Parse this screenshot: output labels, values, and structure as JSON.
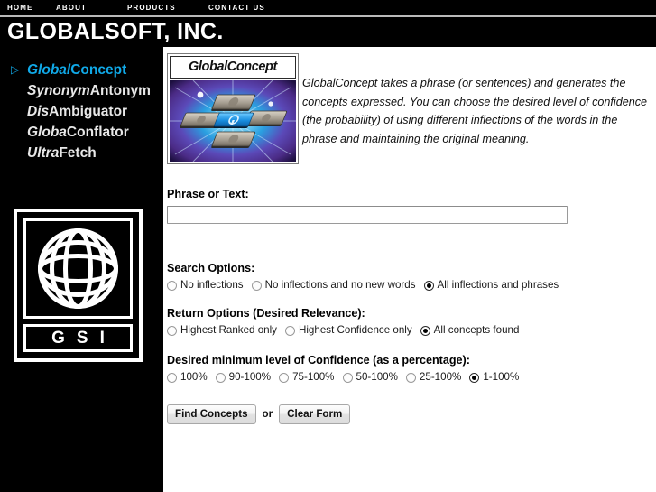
{
  "topnav": {
    "items": [
      {
        "label": "HOME"
      },
      {
        "label": "ABOUT"
      },
      {
        "label": "PRODUCTS"
      },
      {
        "label": "CONTACT US"
      }
    ]
  },
  "masthead": {
    "company": "GLOBALSOFT, INC."
  },
  "sidebar": {
    "items": [
      {
        "pre": "Global",
        "post": "Concept",
        "active": true,
        "marker": "▷"
      },
      {
        "pre": "Synonym",
        "post": "Antonym",
        "active": false,
        "marker": ""
      },
      {
        "pre": "Dis",
        "post": "Ambiguator",
        "active": false,
        "marker": ""
      },
      {
        "pre": "Globa",
        "post": "Conflator",
        "active": false,
        "marker": ""
      },
      {
        "pre": "Ultra",
        "post": "Fetch",
        "active": false,
        "marker": ""
      }
    ],
    "logo": {
      "wordmark": "GSI",
      "icon_name": "globe-grid-icon"
    }
  },
  "main": {
    "banner": {
      "title": "GlobalConcept",
      "art_name": "microchip-burst-image"
    },
    "description": "GlobalConcept takes a phrase (or sentences) and generates the concepts expressed. You can choose the desired level of confidence (the probability) of using different inflections of the words in the phrase and maintaining the original meaning.",
    "form": {
      "phrase_label": "Phrase or Text:",
      "phrase_value": "",
      "phrase_placeholder": "",
      "search_options": {
        "label": "Search Options:",
        "options": [
          {
            "label": "No inflections",
            "checked": false
          },
          {
            "label": "No inflections and no new words",
            "checked": false
          },
          {
            "label": "All inflections and phrases",
            "checked": true
          }
        ]
      },
      "return_options": {
        "label": "Return Options (Desired Relevance):",
        "options": [
          {
            "label": "Highest Ranked only",
            "checked": false
          },
          {
            "label": "Highest Confidence only",
            "checked": false
          },
          {
            "label": "All concepts found",
            "checked": true
          }
        ]
      },
      "confidence": {
        "label": "Desired minimum level of Confidence (as a percentage):",
        "options": [
          {
            "label": "100%",
            "checked": false
          },
          {
            "label": "90-100%",
            "checked": false
          },
          {
            "label": "75-100%",
            "checked": false
          },
          {
            "label": "50-100%",
            "checked": false
          },
          {
            "label": "25-100%",
            "checked": false
          },
          {
            "label": "1-100%",
            "checked": true
          }
        ]
      },
      "submit_label": "Find Concepts",
      "or_label": "or",
      "reset_label": "Clear Form"
    }
  },
  "colors": {
    "accent_cyan": "#10a9e8",
    "chrome_black": "#000000",
    "rule_gray": "#b9b9b9"
  }
}
